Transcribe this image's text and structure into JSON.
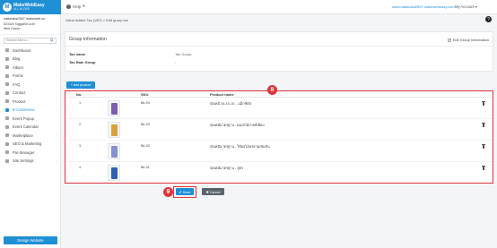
{
  "brand": {
    "name": "MakeWebEasy",
    "tagline": "ALL-IN-ONE"
  },
  "topbar": {
    "help_label": "Help",
    "help_caret": "▾",
    "user_link": "www.nattanika2557.makewebeasy.com",
    "account_label": "My Account",
    "account_caret": "▾"
  },
  "sidebar": {
    "user_name": "nattanika2557.makeweb.co",
    "user_email": "823400 Toggable.co.th",
    "user_role": "Web Owner",
    "search_placeholder": "Search Menu...",
    "items": [
      {
        "label": "Dashboard",
        "icon": "dashboard-icon",
        "caret": ""
      },
      {
        "label": "Blog",
        "icon": "blog-icon",
        "caret": "›"
      },
      {
        "label": "Album",
        "icon": "album-icon",
        "caret": "›"
      },
      {
        "label": "Forms",
        "icon": "forms-icon",
        "caret": "›"
      },
      {
        "label": "FAQ",
        "icon": "faq-icon",
        "caret": "›"
      },
      {
        "label": "Contact",
        "icon": "contact-icon",
        "caret": "›"
      },
      {
        "label": "Product",
        "icon": "product-icon",
        "caret": "›"
      },
      {
        "label": "E-Commerce",
        "icon": "ecommerce-icon",
        "caret": "›"
      },
      {
        "label": "Event Popup",
        "icon": "event-popup-icon",
        "caret": ""
      },
      {
        "label": "Event Calendar",
        "icon": "calendar-icon",
        "caret": ""
      },
      {
        "label": "Marketplace",
        "icon": "marketplace-icon",
        "caret": "›"
      },
      {
        "label": "SEO & Marketing",
        "icon": "seo-icon",
        "caret": "›"
      },
      {
        "label": "File Manager",
        "icon": "file-icon",
        "caret": ""
      },
      {
        "label": "Site Settings",
        "icon": "settings-icon",
        "caret": "›"
      }
    ],
    "design_button": "Design Website"
  },
  "breadcrumb": {
    "parent": "Value Added Tax (VAT)",
    "separator": " > ",
    "current": "Edit group tax"
  },
  "group_info": {
    "title": "Group Information",
    "edit_label": "Edit Group Information",
    "tax_name_label": "Tax name",
    "tax_name_value": "Tax Group",
    "tax_rate_label": "Tax Rate Group",
    "tax_rate_value": "-"
  },
  "product_table": {
    "add_label": "+ Add product",
    "headers": {
      "no": "No.",
      "sku": "SKU",
      "name": "Product name"
    },
    "rows": [
      {
        "no": "1",
        "sku": "Bk-04",
        "name": "ปุ๋ยเคมี 15-15-15 ...แม็กซ์ตัล",
        "pack_color": "#7a5fb0"
      },
      {
        "no": "2",
        "sku": "Bk-03",
        "name": "ปุ๋ยเคมีมาตรฐาน - ผงผลไม้สวยดีเยี่ยม",
        "pack_color": "#d8a23a"
      },
      {
        "no": "3",
        "sku": "Bk-02",
        "name": "ปุ๋ยเคมีมาตรฐาน - ใช้ผลไม้แร่ธาตุเข้มข้น",
        "pack_color": "#8a8fd0"
      },
      {
        "no": "4",
        "sku": "Bk-01",
        "name": "ปุ๋ยเคมีมาตรฐาน - สูตร",
        "pack_color": "#2f5fb0"
      }
    ]
  },
  "annotations": {
    "table_marker": "8",
    "save_marker": "9"
  },
  "actions": {
    "save_label": "✔ Save",
    "cancel_label": "✖ Cancel"
  }
}
